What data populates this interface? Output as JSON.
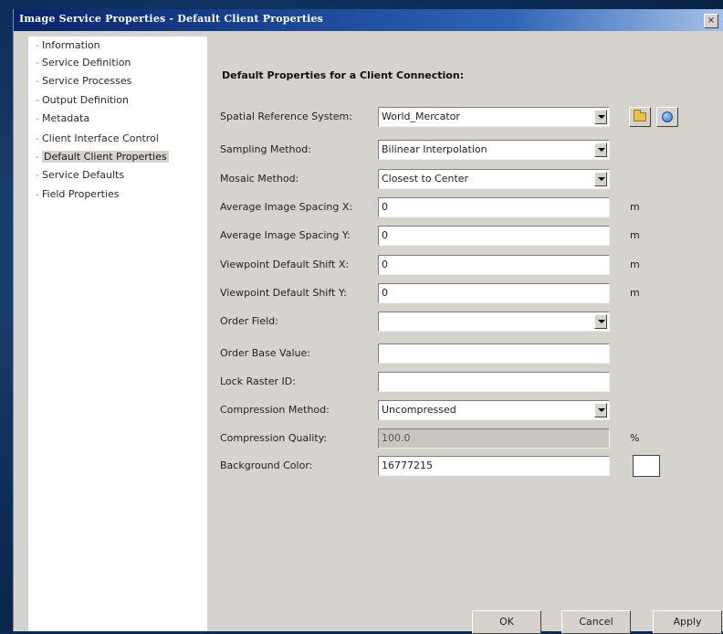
{
  "window": {
    "title": "Image Service Properties - Default Client Properties",
    "close_label": "×"
  },
  "nav": {
    "items": [
      {
        "label": "Information"
      },
      {
        "label": "Service Definition"
      },
      {
        "label": "Service Processes"
      },
      {
        "label": "Output Definition"
      },
      {
        "label": "Metadata"
      },
      {
        "label": "Client Interface Control"
      },
      {
        "label": "Default Client Properties",
        "selected": true
      },
      {
        "label": "Service Defaults"
      },
      {
        "label": "Field Properties"
      }
    ]
  },
  "form": {
    "heading": "Default Properties for a Client Connection:",
    "spatial_reference": {
      "label": "Spatial Reference System:",
      "value": "World_Mercator"
    },
    "sampling_method": {
      "label": "Sampling Method:",
      "value": "Bilinear Interpolation"
    },
    "mosaic_method": {
      "label": "Mosaic Method:",
      "value": "Closest to Center"
    },
    "avg_spacing_x": {
      "label": "Average Image Spacing X:",
      "value": "0",
      "unit": "m"
    },
    "avg_spacing_y": {
      "label": "Average Image Spacing Y:",
      "value": "0",
      "unit": "m"
    },
    "viewpoint_shift_x": {
      "label": "Viewpoint Default Shift X:",
      "value": "0",
      "unit": "m"
    },
    "viewpoint_shift_y": {
      "label": "Viewpoint Default Shift Y:",
      "value": "0",
      "unit": "m"
    },
    "order_field": {
      "label": "Order Field:",
      "value": ""
    },
    "order_base_value": {
      "label": "Order Base Value:",
      "value": ""
    },
    "lock_raster_id": {
      "label": "Lock Raster ID:",
      "value": ""
    },
    "compression_method": {
      "label": "Compression Method:",
      "value": "Uncompressed"
    },
    "compression_quality": {
      "label": "Compression Quality:",
      "value": "100.0",
      "unit": "%"
    },
    "background_color": {
      "label": "Background Color:",
      "value": "16777215",
      "swatch": "#ffffff"
    }
  },
  "buttons": {
    "ok": "OK",
    "cancel": "Cancel",
    "apply": "Apply"
  },
  "icons": {
    "folder": "folder-icon",
    "globe": "globe-icon",
    "dropdown": "chevron-down-icon"
  }
}
